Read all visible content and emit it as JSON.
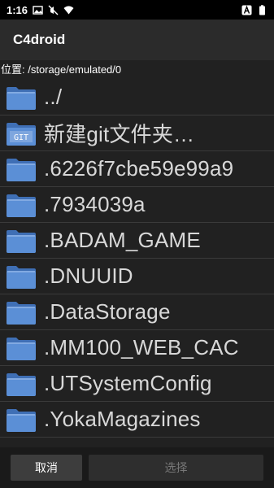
{
  "status_bar": {
    "time": "1:16",
    "left_icons": [
      "gallery-icon",
      "mute-icon",
      "wifi-icon"
    ],
    "right_icons": [
      "a-notification-icon",
      "battery-icon"
    ]
  },
  "app_bar": {
    "title": "C4droid"
  },
  "path": "位置: /storage/emulated/0",
  "files": [
    {
      "name": "../",
      "icon": "folder-icon"
    },
    {
      "name": "新建git文件夹…",
      "icon": "git-folder-icon"
    },
    {
      "name": ".6226f7cbe59e99a9",
      "icon": "folder-icon"
    },
    {
      "name": ".7934039a",
      "icon": "folder-icon"
    },
    {
      "name": ".BADAM_GAME",
      "icon": "folder-icon"
    },
    {
      "name": ".DNUUID",
      "icon": "folder-icon"
    },
    {
      "name": ".DataStorage",
      "icon": "folder-icon"
    },
    {
      "name": ".MM100_WEB_CAC",
      "icon": "folder-icon"
    },
    {
      "name": ".UTSystemConfig",
      "icon": "folder-icon"
    },
    {
      "name": ".YokaMagazines",
      "icon": "folder-icon"
    }
  ],
  "buttons": {
    "cancel": "取消",
    "select": "选择"
  },
  "colors": {
    "folder": "#5b8fd6",
    "background": "#212121",
    "app_bar": "#2b2b2b"
  }
}
